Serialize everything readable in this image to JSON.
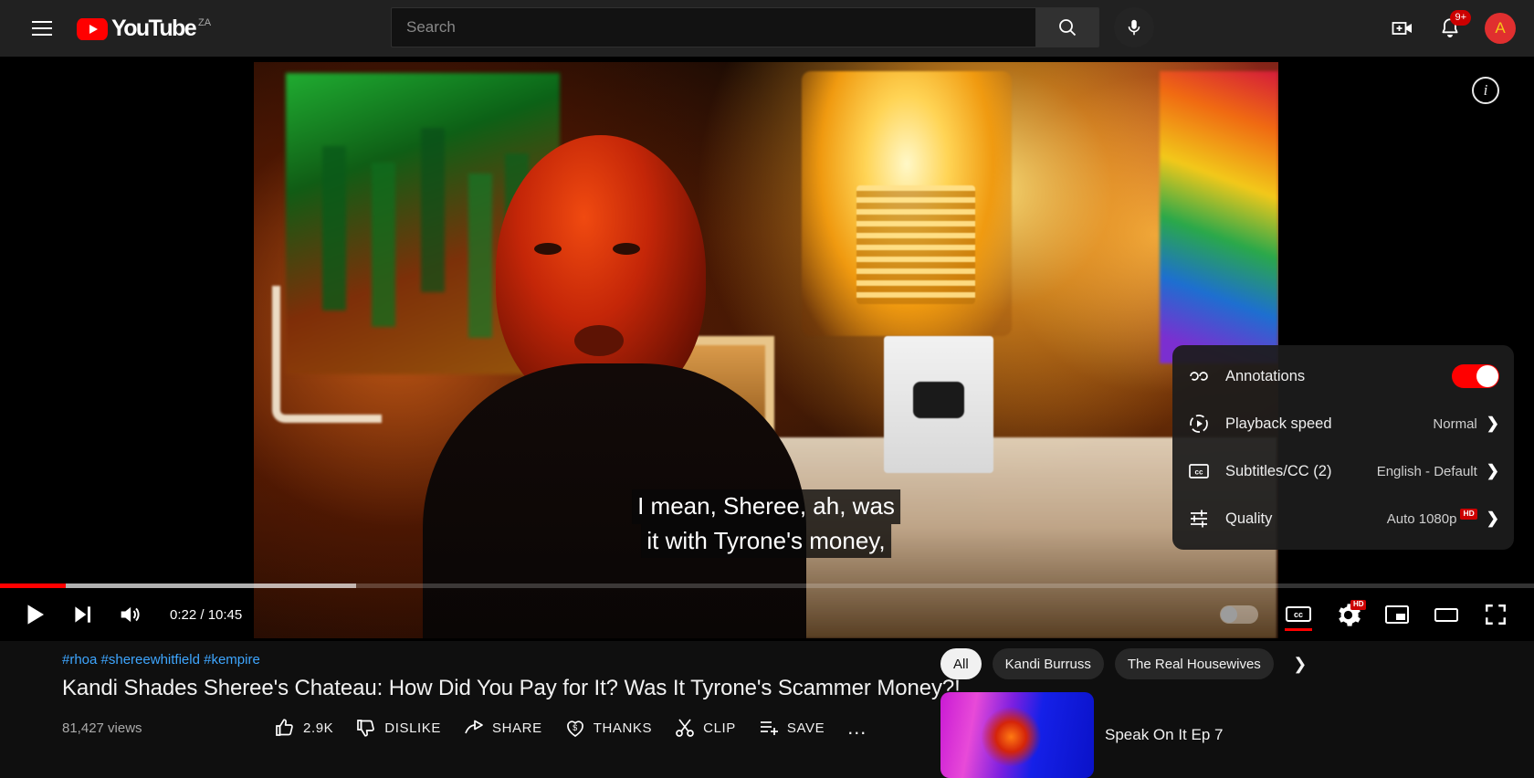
{
  "header": {
    "menu_icon": "hamburger-icon",
    "logo_text": "YouTube",
    "logo_country": "ZA",
    "search_placeholder": "Search",
    "search_value": "",
    "search_icon": "search-icon",
    "mic_icon": "microphone-icon",
    "create_icon": "create-video-icon",
    "notifications_icon": "bell-icon",
    "notifications_badge": "9+",
    "avatar_initial": "A",
    "avatar_bg": "#e02f2f"
  },
  "player": {
    "info_icon": "info-icon",
    "captions": [
      "I mean, Sheree, ah, was",
      "it with Tyrone's money,"
    ],
    "progress": {
      "played_percent": 4.3,
      "loaded_percent": 23.2,
      "played_color": "#ff0000"
    },
    "controls": {
      "play_icon": "play-icon",
      "next_icon": "next-video-icon",
      "volume_icon": "volume-icon",
      "time": "0:22 / 10:45",
      "autoplay_label": "autoplay-toggle",
      "autoplay_on": false,
      "subtitles_icon": "closed-captions-icon",
      "subtitles_active": true,
      "settings_icon": "gear-icon",
      "settings_badge": "HD",
      "miniplayer_icon": "miniplayer-icon",
      "theater_icon": "theater-mode-icon",
      "fullscreen_icon": "fullscreen-icon"
    },
    "settings_menu": {
      "rows": [
        {
          "icon": "annotations-icon",
          "label": "Annotations",
          "value": "",
          "control": "toggle",
          "toggle_on": true
        },
        {
          "icon": "playback-speed-icon",
          "label": "Playback speed",
          "value": "Normal",
          "control": "chevron",
          "badge": ""
        },
        {
          "icon": "cc-icon",
          "label": "Subtitles/CC (2)",
          "value": "English - Default",
          "control": "chevron",
          "badge": ""
        },
        {
          "icon": "quality-icon",
          "label": "Quality",
          "value": "Auto 1080p",
          "control": "chevron",
          "badge": "HD"
        }
      ],
      "toggle_on_color": "#ff0000"
    }
  },
  "below": {
    "hashtags": "#rhoa #shereewhitfield #kempire",
    "hashtag_color": "#3ea6ff",
    "title": "Kandi Shades Sheree's Chateau: How Did You Pay for It? Was It Tyrone's Scammer Money?!",
    "views": "81,427 views",
    "actions": [
      {
        "icon": "thumbs-up-icon",
        "label": "2.9K"
      },
      {
        "icon": "thumbs-down-icon",
        "label": "DISLIKE"
      },
      {
        "icon": "share-icon",
        "label": "SHARE"
      },
      {
        "icon": "thanks-icon",
        "label": "THANKS"
      },
      {
        "icon": "clip-icon",
        "label": "CLIP"
      },
      {
        "icon": "save-icon",
        "label": "SAVE"
      }
    ],
    "more_actions": "…"
  },
  "sidebar": {
    "chips": [
      {
        "label": "All",
        "active": true
      },
      {
        "label": "Kandi Burruss",
        "active": false
      },
      {
        "label": "The Real Housewives",
        "active": false
      }
    ],
    "chip_next_icon": "chevron-right-icon",
    "recommendations": [
      {
        "title": "Speak On It Ep 7"
      }
    ]
  }
}
